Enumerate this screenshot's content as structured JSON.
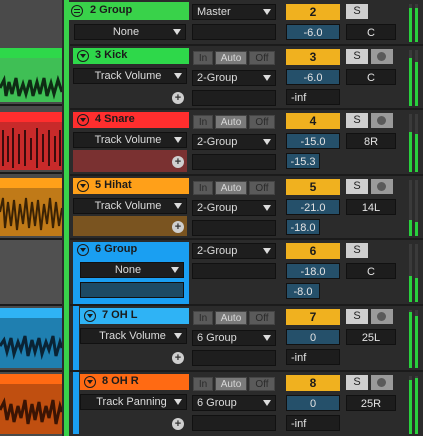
{
  "colors": {
    "group2": "#39d24a",
    "kick": "#2ed84a",
    "snare": "#ff2e2e",
    "hihat": "#ffa019",
    "group6": "#1a9ff2",
    "ohl": "#2fb3f5",
    "ohr": "#ff6a13"
  },
  "tracks": [
    {
      "name": "2 Group",
      "input": "None",
      "output": "Master",
      "number": "2",
      "volume": "-6.0",
      "pan": "C",
      "color": "#39d24a",
      "icon": "group-fold-icon"
    },
    {
      "name": "3 Kick",
      "input": "Track Volume",
      "output": "2-Group",
      "number": "3",
      "volume": "-6.0",
      "pan": "C",
      "send": "-inf",
      "color": "#2ed84a"
    },
    {
      "name": "4 Snare",
      "input": "Track Volume",
      "output": "2-Group",
      "number": "4",
      "volume": "-15.0",
      "pan": "8R",
      "send": "-15.3",
      "color": "#ff2e2e"
    },
    {
      "name": "5 Hihat",
      "input": "Track Volume",
      "output": "2-Group",
      "number": "5",
      "volume": "-21.0",
      "pan": "14L",
      "send": "-18.0",
      "color": "#ffa019"
    },
    {
      "name": "6 Group",
      "input": "None",
      "output": "2-Group",
      "number": "6",
      "volume": "-18.0",
      "pan": "C",
      "send": "-8.0",
      "color": "#1a9ff2"
    },
    {
      "name": "7 OH L",
      "input": "Track Volume",
      "output": "6 Group",
      "number": "7",
      "volume": "0",
      "pan": "25L",
      "send": "-inf",
      "color": "#2fb3f5"
    },
    {
      "name": "8 OH R",
      "input": "Track Panning",
      "output": "6 Group",
      "number": "8",
      "volume": "0",
      "pan": "25R",
      "send": "-inf",
      "color": "#ff6a13"
    }
  ],
  "monitor": {
    "in": "In",
    "auto": "Auto",
    "off": "Off"
  },
  "solo_label": "S"
}
